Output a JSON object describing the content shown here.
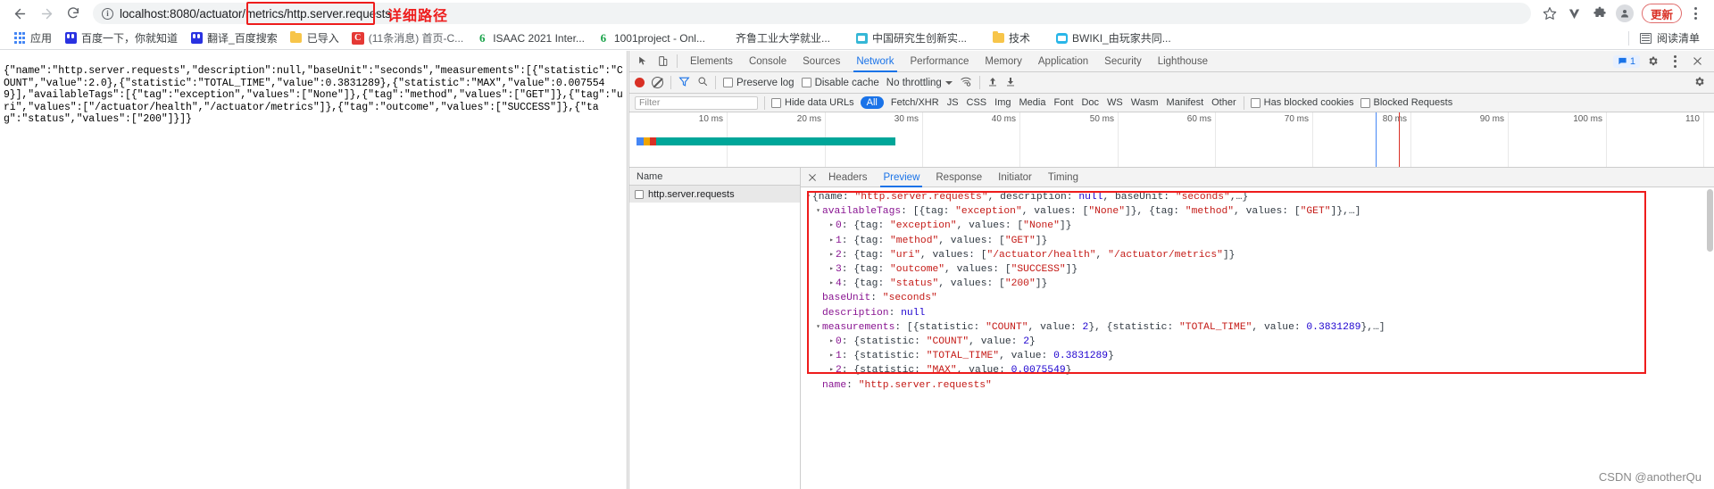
{
  "browser": {
    "nav": {
      "back": "←",
      "forward": "→",
      "reload": "⟳"
    },
    "omnibox": {
      "info_icon": "i",
      "url_prefix": "localhost:8080/actuator/metrics",
      "url_highlighted": "/http.server.requests",
      "full_url": "localhost:8080/actuator/metrics/http.server.requests"
    },
    "annotation": "详细路径",
    "right_icons": {
      "bookmark_star": "☆",
      "extension_v": "V",
      "puzzle_icon": "puzzle",
      "profile_icon": "avatar",
      "update_label": "更新",
      "menu_icon": "kebab"
    },
    "bookmarks": [
      {
        "icon": "apps-grid-icon",
        "label": "应用"
      },
      {
        "icon": "baidu-icon",
        "label": "百度一下，你就知道"
      },
      {
        "icon": "baidu-icon",
        "label": "翻译_百度搜索"
      },
      {
        "icon": "folder-icon",
        "label": "已导入"
      },
      {
        "icon": "csdn-icon",
        "label": "(11条消息) 首页-C..."
      },
      {
        "icon": "green-6-icon",
        "label": "ISAAC 2021 Inter..."
      },
      {
        "icon": "green-6-icon",
        "label": "1001project - Onl..."
      },
      {
        "icon": "none",
        "label": "齐鲁工业大学就业..."
      },
      {
        "icon": "teal-icon",
        "label": "中国研究生创新实..."
      },
      {
        "icon": "folder-icon",
        "label": "技术"
      },
      {
        "icon": "bwiki-icon",
        "label": "BWIKI_由玩家共同..."
      }
    ],
    "reading_list": {
      "icon": "reading-list-icon",
      "label": "阅读清单"
    }
  },
  "page": {
    "raw_json": "{\"name\":\"http.server.requests\",\"description\":null,\"baseUnit\":\"seconds\",\"measurements\":[{\"statistic\":\"COUNT\",\"value\":2.0},{\"statistic\":\"TOTAL_TIME\",\"value\":0.3831289},{\"statistic\":\"MAX\",\"value\":0.0075549}],\"availableTags\":[{\"tag\":\"exception\",\"values\":[\"None\"]},{\"tag\":\"method\",\"values\":[\"GET\"]},{\"tag\":\"uri\",\"values\":[\"/actuator/health\",\"/actuator/metrics\"]},{\"tag\":\"outcome\",\"values\":[\"SUCCESS\"]},{\"tag\":\"status\",\"values\":[\"200\"]}]}"
  },
  "devtools": {
    "tabs": [
      {
        "label": "Elements",
        "active": false
      },
      {
        "label": "Console",
        "active": false
      },
      {
        "label": "Sources",
        "active": false
      },
      {
        "label": "Network",
        "active": true
      },
      {
        "label": "Performance",
        "active": false
      },
      {
        "label": "Memory",
        "active": false
      },
      {
        "label": "Application",
        "active": false
      },
      {
        "label": "Security",
        "active": false
      },
      {
        "label": "Lighthouse",
        "active": false
      }
    ],
    "message_count": "1",
    "toolbar": {
      "record_icon": "record-icon",
      "clear_icon": "clear-icon",
      "filter_icon": "filter-icon",
      "search_icon": "search-icon",
      "preserve_log": "Preserve log",
      "disable_cache": "Disable cache",
      "throttling": "No throttling",
      "import_icon": "import-icon",
      "export_icon": "export-icon",
      "settings_icon": "gear-icon"
    },
    "filterbar": {
      "filter_placeholder": "Filter",
      "hide_data_urls": "Hide data URLs",
      "types": [
        "All",
        "Fetch/XHR",
        "JS",
        "CSS",
        "Img",
        "Media",
        "Font",
        "Doc",
        "WS",
        "Wasm",
        "Manifest",
        "Other"
      ],
      "selected_type": "All",
      "has_blocked_cookies": "Has blocked cookies",
      "blocked_requests": "Blocked Requests"
    },
    "timeline": {
      "ticks": [
        "10 ms",
        "20 ms",
        "30 ms",
        "40 ms",
        "50 ms",
        "60 ms",
        "70 ms",
        "80 ms",
        "90 ms",
        "100 ms",
        "110"
      ]
    },
    "request_list": {
      "column_header": "Name",
      "rows": [
        {
          "name": "http.server.requests"
        }
      ]
    },
    "detail_tabs": [
      {
        "label": "Headers",
        "active": false
      },
      {
        "label": "Preview",
        "active": true
      },
      {
        "label": "Response",
        "active": false
      },
      {
        "label": "Initiator",
        "active": false
      },
      {
        "label": "Timing",
        "active": false
      }
    ],
    "preview": {
      "lines": [
        {
          "indent": 0,
          "arrow": "▾",
          "parts": [
            {
              "t": "{name: ",
              "c": "plain"
            },
            {
              "t": "\"http.server.requests\"",
              "c": "str"
            },
            {
              "t": ", description: ",
              "c": "plain"
            },
            {
              "t": "null",
              "c": "null"
            },
            {
              "t": ", baseUnit: ",
              "c": "plain"
            },
            {
              "t": "\"seconds\"",
              "c": "str"
            },
            {
              "t": ",…}",
              "c": "plain"
            }
          ]
        },
        {
          "indent": 1,
          "arrow": "▾",
          "parts": [
            {
              "t": "availableTags",
              "c": "prop"
            },
            {
              "t": ": [{tag: ",
              "c": "plain"
            },
            {
              "t": "\"exception\"",
              "c": "str"
            },
            {
              "t": ", values: [",
              "c": "plain"
            },
            {
              "t": "\"None\"",
              "c": "str"
            },
            {
              "t": "]}, {tag: ",
              "c": "plain"
            },
            {
              "t": "\"method\"",
              "c": "str"
            },
            {
              "t": ", values: [",
              "c": "plain"
            },
            {
              "t": "\"GET\"",
              "c": "str"
            },
            {
              "t": "]},…]",
              "c": "plain"
            }
          ]
        },
        {
          "indent": 2,
          "arrow": "▸",
          "parts": [
            {
              "t": "0",
              "c": "prop"
            },
            {
              "t": ": {tag: ",
              "c": "plain"
            },
            {
              "t": "\"exception\"",
              "c": "str"
            },
            {
              "t": ", values: [",
              "c": "plain"
            },
            {
              "t": "\"None\"",
              "c": "str"
            },
            {
              "t": "]}",
              "c": "plain"
            }
          ]
        },
        {
          "indent": 2,
          "arrow": "▸",
          "parts": [
            {
              "t": "1",
              "c": "prop"
            },
            {
              "t": ": {tag: ",
              "c": "plain"
            },
            {
              "t": "\"method\"",
              "c": "str"
            },
            {
              "t": ", values: [",
              "c": "plain"
            },
            {
              "t": "\"GET\"",
              "c": "str"
            },
            {
              "t": "]}",
              "c": "plain"
            }
          ]
        },
        {
          "indent": 2,
          "arrow": "▸",
          "parts": [
            {
              "t": "2",
              "c": "prop"
            },
            {
              "t": ": {tag: ",
              "c": "plain"
            },
            {
              "t": "\"uri\"",
              "c": "str"
            },
            {
              "t": ", values: [",
              "c": "plain"
            },
            {
              "t": "\"/actuator/health\"",
              "c": "str"
            },
            {
              "t": ", ",
              "c": "plain"
            },
            {
              "t": "\"/actuator/metrics\"",
              "c": "str"
            },
            {
              "t": "]}",
              "c": "plain"
            }
          ]
        },
        {
          "indent": 2,
          "arrow": "▸",
          "parts": [
            {
              "t": "3",
              "c": "prop"
            },
            {
              "t": ": {tag: ",
              "c": "plain"
            },
            {
              "t": "\"outcome\"",
              "c": "str"
            },
            {
              "t": ", values: [",
              "c": "plain"
            },
            {
              "t": "\"SUCCESS\"",
              "c": "str"
            },
            {
              "t": "]}",
              "c": "plain"
            }
          ]
        },
        {
          "indent": 2,
          "arrow": "▸",
          "parts": [
            {
              "t": "4",
              "c": "prop"
            },
            {
              "t": ": {tag: ",
              "c": "plain"
            },
            {
              "t": "\"status\"",
              "c": "str"
            },
            {
              "t": ", values: [",
              "c": "plain"
            },
            {
              "t": "\"200\"",
              "c": "str"
            },
            {
              "t": "]}",
              "c": "plain"
            }
          ]
        },
        {
          "indent": 1,
          "arrow": "",
          "parts": [
            {
              "t": "baseUnit",
              "c": "prop"
            },
            {
              "t": ": ",
              "c": "plain"
            },
            {
              "t": "\"seconds\"",
              "c": "str"
            }
          ]
        },
        {
          "indent": 1,
          "arrow": "",
          "parts": [
            {
              "t": "description",
              "c": "prop"
            },
            {
              "t": ": ",
              "c": "plain"
            },
            {
              "t": "null",
              "c": "null"
            }
          ]
        },
        {
          "indent": 1,
          "arrow": "▾",
          "parts": [
            {
              "t": "measurements",
              "c": "prop"
            },
            {
              "t": ": [{statistic: ",
              "c": "plain"
            },
            {
              "t": "\"COUNT\"",
              "c": "str"
            },
            {
              "t": ", value: ",
              "c": "plain"
            },
            {
              "t": "2",
              "c": "num"
            },
            {
              "t": "}, {statistic: ",
              "c": "plain"
            },
            {
              "t": "\"TOTAL_TIME\"",
              "c": "str"
            },
            {
              "t": ", value: ",
              "c": "plain"
            },
            {
              "t": "0.3831289",
              "c": "num"
            },
            {
              "t": "},…]",
              "c": "plain"
            }
          ]
        },
        {
          "indent": 2,
          "arrow": "▸",
          "parts": [
            {
              "t": "0",
              "c": "prop"
            },
            {
              "t": ": {statistic: ",
              "c": "plain"
            },
            {
              "t": "\"COUNT\"",
              "c": "str"
            },
            {
              "t": ", value: ",
              "c": "plain"
            },
            {
              "t": "2",
              "c": "num"
            },
            {
              "t": "}",
              "c": "plain"
            }
          ]
        },
        {
          "indent": 2,
          "arrow": "▸",
          "parts": [
            {
              "t": "1",
              "c": "prop"
            },
            {
              "t": ": {statistic: ",
              "c": "plain"
            },
            {
              "t": "\"TOTAL_TIME\"",
              "c": "str"
            },
            {
              "t": ", value: ",
              "c": "plain"
            },
            {
              "t": "0.3831289",
              "c": "num"
            },
            {
              "t": "}",
              "c": "plain"
            }
          ]
        },
        {
          "indent": 2,
          "arrow": "▸",
          "parts": [
            {
              "t": "2",
              "c": "prop"
            },
            {
              "t": ": {statistic: ",
              "c": "plain"
            },
            {
              "t": "\"MAX\"",
              "c": "str"
            },
            {
              "t": ", value: ",
              "c": "plain"
            },
            {
              "t": "0.0075549",
              "c": "num"
            },
            {
              "t": "}",
              "c": "plain"
            }
          ]
        },
        {
          "indent": 1,
          "arrow": "",
          "parts": [
            {
              "t": "name",
              "c": "prop"
            },
            {
              "t": ": ",
              "c": "plain"
            },
            {
              "t": "\"http.server.requests\"",
              "c": "str"
            }
          ]
        }
      ]
    }
  },
  "watermark": "CSDN @anotherQu",
  "colors": {
    "accent_blue": "#1a73e8",
    "annotation_red": "#ee1c1c",
    "record_red": "#d93025",
    "json_string": "#c41a16",
    "json_prop": "#881391",
    "json_number": "#1c00cf",
    "toolbar_bg": "#f3f3f3"
  }
}
